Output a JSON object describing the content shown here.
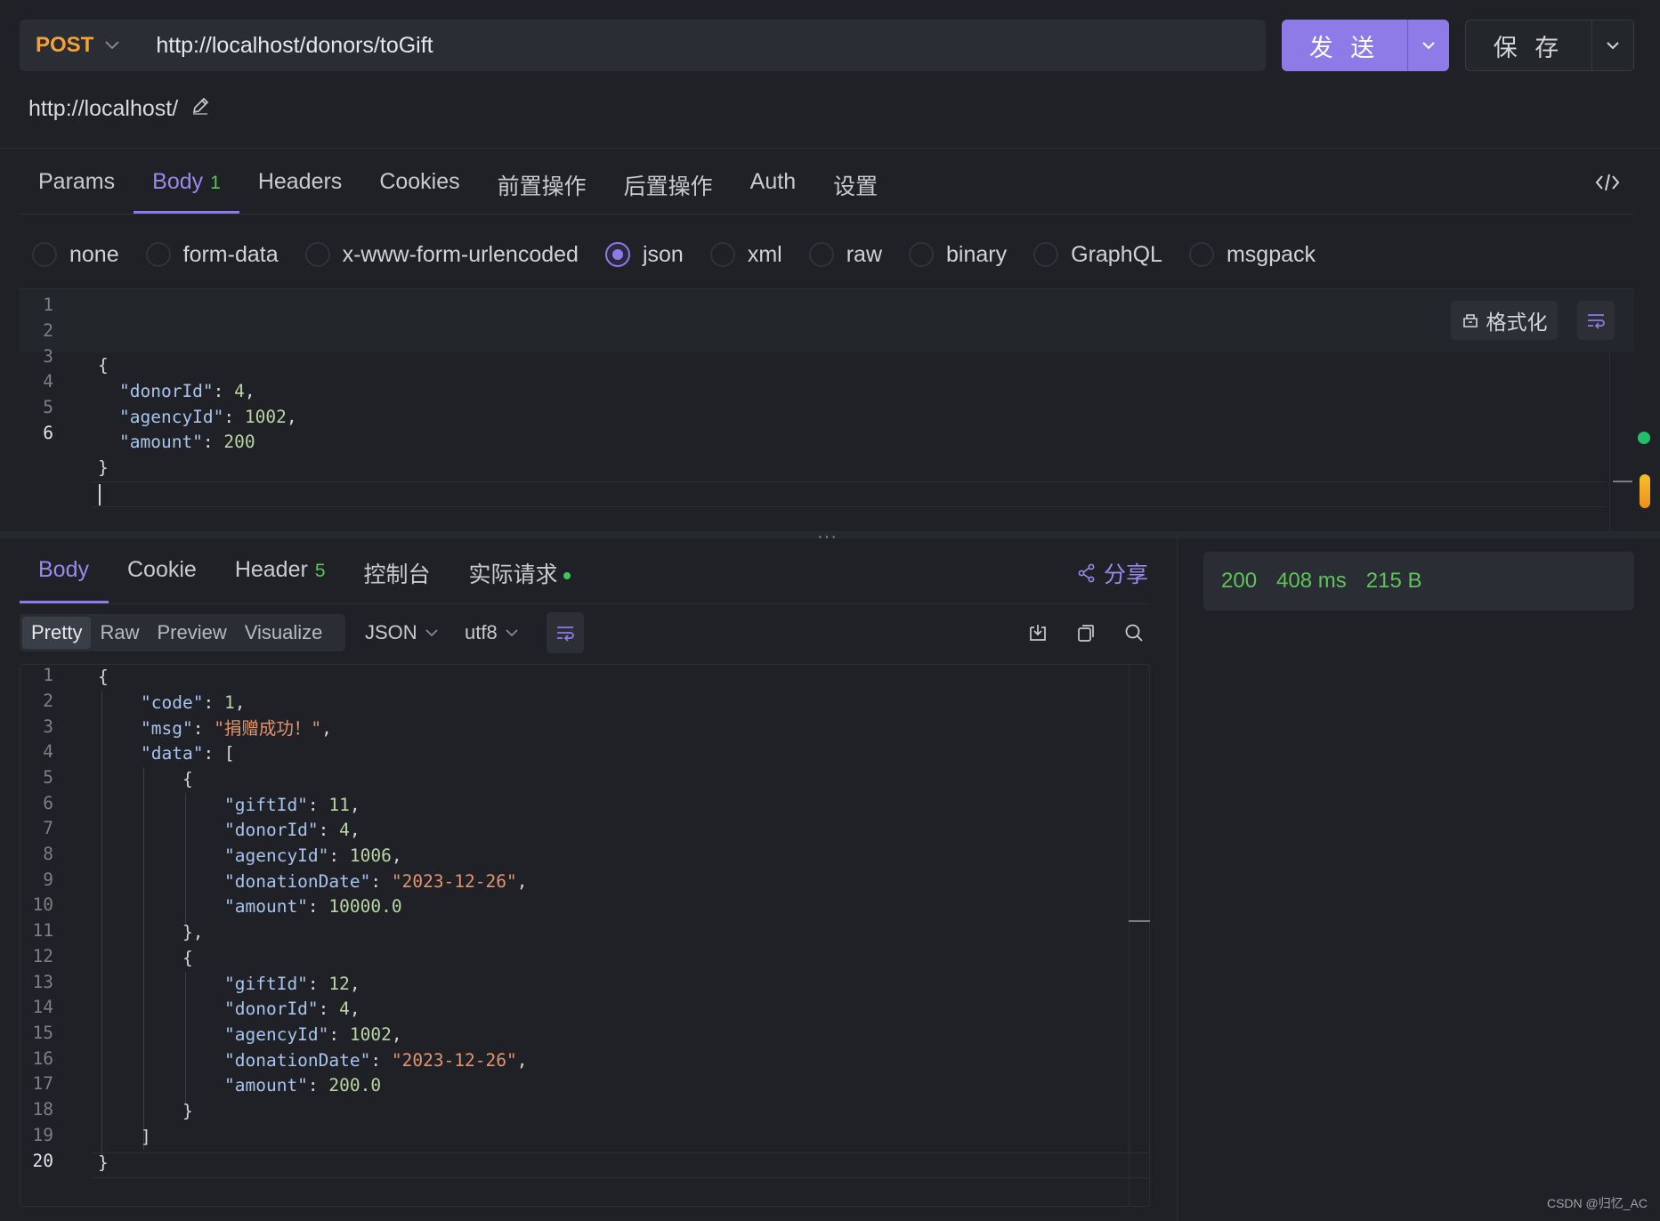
{
  "url_bar": {
    "method": "POST",
    "url": "http://localhost/donors/toGift",
    "send_label": "发 送",
    "save_label": "保 存"
  },
  "base_url": "http://localhost/",
  "request_tabs": [
    {
      "label": "Params"
    },
    {
      "label": "Body",
      "badge": "1",
      "active": true
    },
    {
      "label": "Headers"
    },
    {
      "label": "Cookies"
    },
    {
      "label": "前置操作"
    },
    {
      "label": "后置操作"
    },
    {
      "label": "Auth"
    },
    {
      "label": "设置"
    }
  ],
  "body_types": [
    "none",
    "form-data",
    "x-www-form-urlencoded",
    "json",
    "xml",
    "raw",
    "binary",
    "GraphQL",
    "msgpack"
  ],
  "body_type_selected": "json",
  "format_label": "格式化",
  "request_body": {
    "line_numbers": [
      "1",
      "2",
      "3",
      "4",
      "5",
      "6"
    ],
    "k_donorId": "\"donorId\"",
    "v_donorId": "4",
    "k_agencyId": "\"agencyId\"",
    "v_agencyId": "1002",
    "k_amount": "\"amount\"",
    "v_amount": "200"
  },
  "response_tabs": [
    {
      "label": "Body",
      "active": true
    },
    {
      "label": "Cookie"
    },
    {
      "label": "Header",
      "badge": "5"
    },
    {
      "label": "控制台"
    },
    {
      "label": "实际请求",
      "dot": true
    }
  ],
  "share_label": "分享",
  "status": {
    "code": "200",
    "time": "408 ms",
    "size": "215 B"
  },
  "view_modes": [
    "Pretty",
    "Raw",
    "Preview",
    "Visualize"
  ],
  "view_selected": "Pretty",
  "format_select": "JSON",
  "encoding_select": "utf8",
  "response_body": {
    "line_numbers": [
      "1",
      "2",
      "3",
      "4",
      "5",
      "6",
      "7",
      "8",
      "9",
      "10",
      "11",
      "12",
      "13",
      "14",
      "15",
      "16",
      "17",
      "18",
      "19",
      "20"
    ],
    "k_code": "\"code\"",
    "v_code": "1",
    "k_msg": "\"msg\"",
    "v_msg": "\"捐赠成功！\"",
    "k_data": "\"data\"",
    "items": [
      {
        "k_giftId": "\"giftId\"",
        "v_giftId": "11",
        "k_donorId": "\"donorId\"",
        "v_donorId": "4",
        "k_agencyId": "\"agencyId\"",
        "v_agencyId": "1006",
        "k_donationDate": "\"donationDate\"",
        "v_donationDate": "\"2023-12-26\"",
        "k_amount": "\"amount\"",
        "v_amount": "10000.0"
      },
      {
        "k_giftId": "\"giftId\"",
        "v_giftId": "12",
        "k_donorId": "\"donorId\"",
        "v_donorId": "4",
        "k_agencyId": "\"agencyId\"",
        "v_agencyId": "1002",
        "k_donationDate": "\"donationDate\"",
        "v_donationDate": "\"2023-12-26\"",
        "k_amount": "\"amount\"",
        "v_amount": "200.0"
      }
    ]
  },
  "watermark": "CSDN @归忆_AC",
  "colors": {
    "accent": "#8f7be8",
    "method": "#f0a33a",
    "success": "#5ec45a",
    "string": "#e2946e",
    "key": "#a7c4ee",
    "number": "#b9d6a2"
  },
  "icons": [
    "chevron-down-icon",
    "edit-pencil-icon",
    "code-icon",
    "format-icon",
    "wrap-icon",
    "share-icon",
    "download-icon",
    "copy-icon",
    "search-icon"
  ]
}
